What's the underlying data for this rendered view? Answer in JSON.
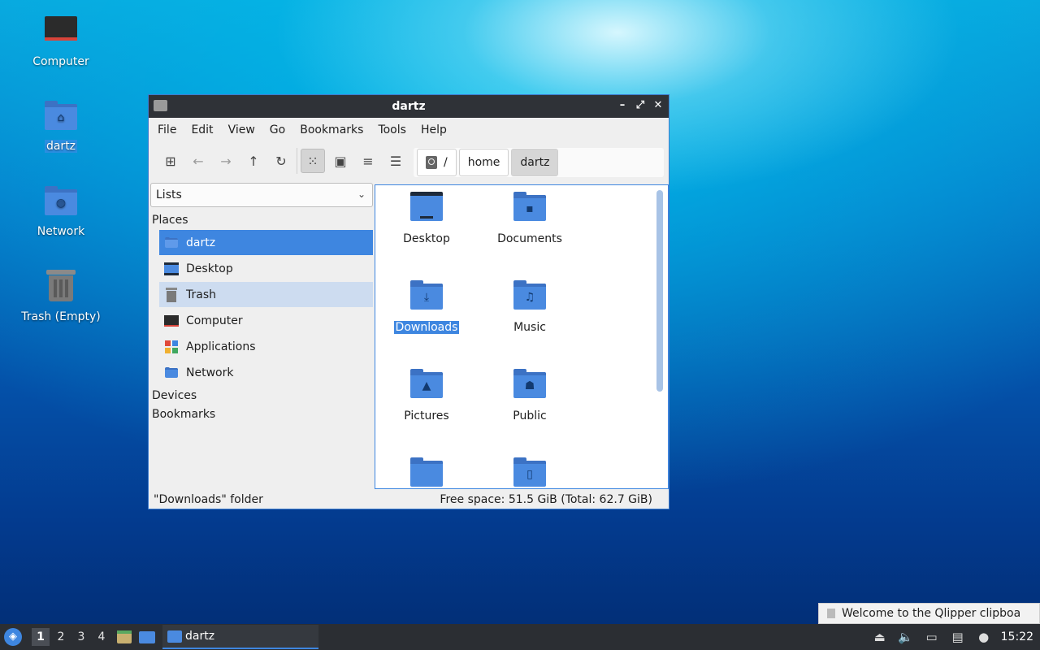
{
  "desktop": {
    "icons": [
      {
        "label": "Computer"
      },
      {
        "label": "dartz"
      },
      {
        "label": "Network"
      },
      {
        "label": "Trash (Empty)"
      }
    ]
  },
  "window": {
    "title": "dartz",
    "controls": {
      "minimize": "–",
      "maximize": "⤢",
      "close": "✕"
    },
    "menu": [
      "File",
      "Edit",
      "View",
      "Go",
      "Bookmarks",
      "Tools",
      "Help"
    ],
    "toolbar": {
      "new_tab": "⊞",
      "back": "←",
      "forward": "→",
      "up": "↑",
      "reload": "↻",
      "icon_view": "⁙",
      "thumb_view": "▣",
      "compact_view": "≡",
      "detail_view": "☰"
    },
    "path": {
      "root": "/",
      "crumbs": [
        "home",
        "dartz"
      ]
    },
    "side_combo": {
      "value": "Lists",
      "arrow": "⌄"
    },
    "sections": {
      "places": "Places",
      "devices": "Devices",
      "bookmarks": "Bookmarks"
    },
    "places": [
      {
        "label": "dartz"
      },
      {
        "label": "Desktop"
      },
      {
        "label": "Trash"
      },
      {
        "label": "Computer"
      },
      {
        "label": "Applications"
      },
      {
        "label": "Network"
      }
    ],
    "files": [
      {
        "name": "Desktop"
      },
      {
        "name": "Documents"
      },
      {
        "name": "Downloads"
      },
      {
        "name": "Music"
      },
      {
        "name": "Pictures"
      },
      {
        "name": "Public"
      },
      {
        "name": ""
      },
      {
        "name": ""
      }
    ],
    "status": {
      "left": "\"Downloads\" folder",
      "right": "Free space: 51.5 GiB (Total: 62.7 GiB)"
    }
  },
  "notification": {
    "text": "Welcome to the Qlipper clipboa"
  },
  "taskbar": {
    "workspaces": [
      "1",
      "2",
      "3",
      "4"
    ],
    "task_label": "dartz",
    "clock": "15:22"
  },
  "colors": {
    "accent": "#3e86e0",
    "folder": "#4a8ae0",
    "titlebar": "#2f3237"
  }
}
